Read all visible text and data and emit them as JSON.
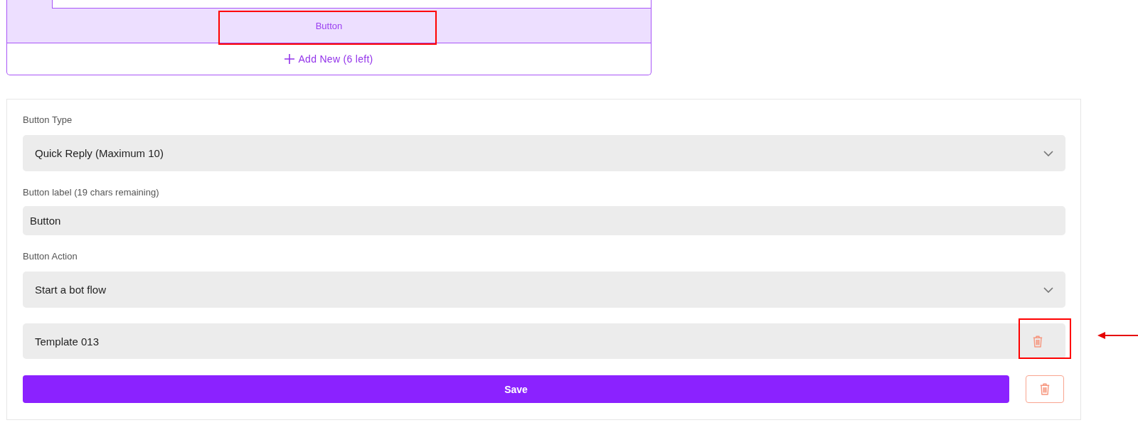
{
  "message_preview": {
    "quick_replies": [
      {
        "label": "Button",
        "highlighted": true
      }
    ],
    "add_new_label": "Add New (6 left)"
  },
  "form": {
    "fields": [
      {
        "kind": "select",
        "label": "Button Type",
        "value": "Quick Reply (Maximum 10)"
      },
      {
        "kind": "text",
        "label": "Button label (19 chars remaining)",
        "value": "Button"
      },
      {
        "kind": "select",
        "label": "Button Action",
        "value": "Start a bot flow"
      },
      {
        "kind": "removable",
        "value": "Template 013",
        "remove_highlighted": true,
        "pointer_arrow": true
      }
    ],
    "save_label": "Save"
  }
}
